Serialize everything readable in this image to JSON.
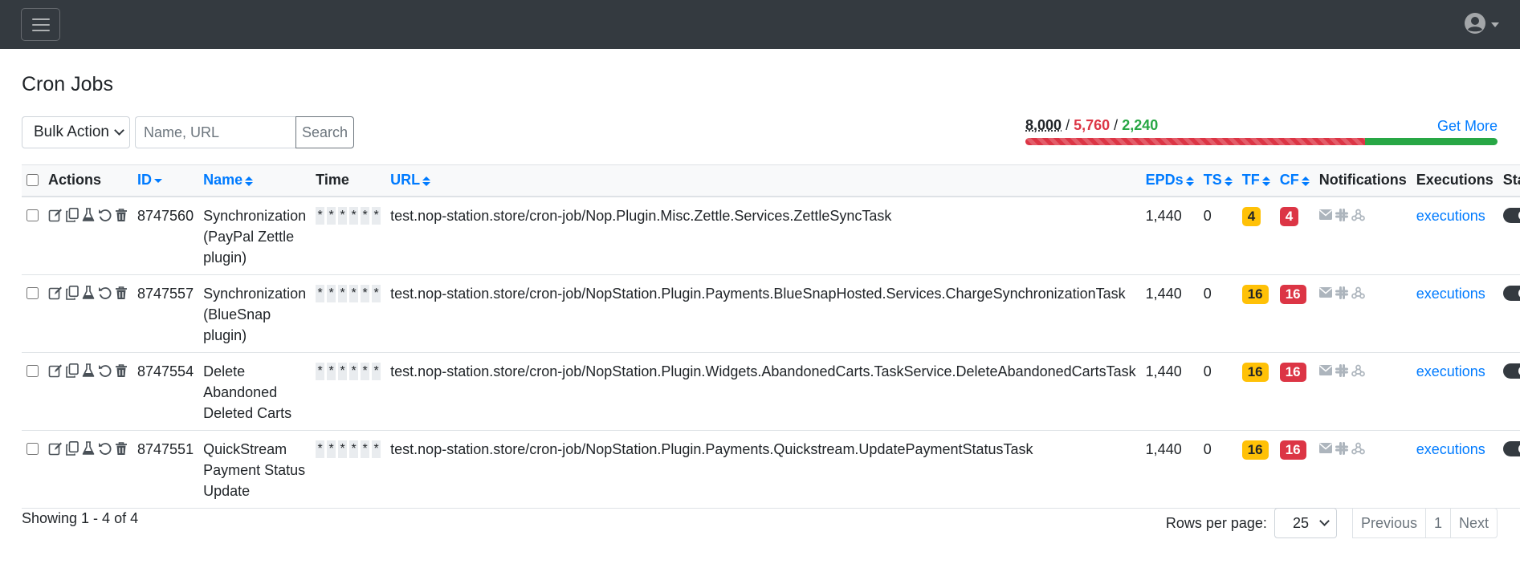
{
  "header": {
    "menu_icon": "hamburger-menu-icon",
    "user_icon": "user-circle-icon"
  },
  "page": {
    "title": "Cron Jobs"
  },
  "toolbar": {
    "bulk_action": "Bulk Action",
    "search_placeholder": "Name, URL",
    "search_label": "Search"
  },
  "quota": {
    "total": "8,000",
    "used": "5,760",
    "left": "2,240",
    "separator": "/",
    "used_fraction": 0.72,
    "get_more": "Get More",
    "colors": {
      "used": "#dc3545",
      "left": "#28a745"
    }
  },
  "table": {
    "headers": {
      "actions": "Actions",
      "id": "ID",
      "name": "Name",
      "time": "Time",
      "url": "URL",
      "epds": "EPDs",
      "ts": "TS",
      "tf": "TF",
      "cf": "CF",
      "notifications": "Notifications",
      "executions": "Executions",
      "status": "Status"
    },
    "rows": [
      {
        "id": "8747560",
        "name": [
          "Synchronization",
          "(PayPal Zettle",
          "plugin)"
        ],
        "cron": [
          "*",
          "*",
          "*",
          "*",
          "*",
          "*"
        ],
        "url": "test.nop-station.store/cron-job/Nop.Plugin.Misc.Zettle.Services.ZettleSyncTask",
        "epds": "1,440",
        "ts": "0",
        "tf": "4",
        "cf": "4",
        "executions": "executions",
        "enabled": true
      },
      {
        "id": "8747557",
        "name": [
          "Synchronization",
          "(BlueSnap",
          "plugin)"
        ],
        "cron": [
          "*",
          "*",
          "*",
          "*",
          "*",
          "*"
        ],
        "url": "test.nop-station.store/cron-job/NopStation.Plugin.Payments.BlueSnapHosted.Services.ChargeSynchronizationTask",
        "epds": "1,440",
        "ts": "0",
        "tf": "16",
        "cf": "16",
        "executions": "executions",
        "enabled": true
      },
      {
        "id": "8747554",
        "name": [
          "Delete",
          "Abandoned",
          "Deleted Carts"
        ],
        "cron": [
          "*",
          "*",
          "*",
          "*",
          "*",
          "*"
        ],
        "url": "test.nop-station.store/cron-job/NopStation.Plugin.Widgets.AbandonedCarts.TaskService.DeleteAbandonedCartsTask",
        "epds": "1,440",
        "ts": "0",
        "tf": "16",
        "cf": "16",
        "executions": "executions",
        "enabled": true
      },
      {
        "id": "8747551",
        "name": [
          "QuickStream",
          "Payment Status",
          "Update"
        ],
        "cron": [
          "*",
          "*",
          "*",
          "*",
          "*",
          "*"
        ],
        "url": "test.nop-station.store/cron-job/NopStation.Plugin.Payments.Quickstream.UpdatePaymentStatusTask",
        "epds": "1,440",
        "ts": "0",
        "tf": "16",
        "cf": "16",
        "executions": "executions",
        "enabled": true
      }
    ]
  },
  "footer": {
    "showing": "Showing 1 - 4 of 4",
    "rows_per_page_label": "Rows per page:",
    "rows_per_page": "25",
    "previous": "Previous",
    "page": "1",
    "next": "Next"
  }
}
